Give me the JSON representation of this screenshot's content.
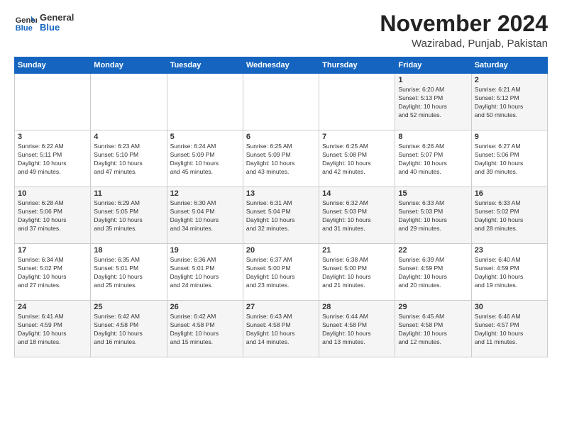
{
  "logo": {
    "general": "General",
    "blue": "Blue"
  },
  "header": {
    "month": "November 2024",
    "location": "Wazirabad, Punjab, Pakistan"
  },
  "days_of_week": [
    "Sunday",
    "Monday",
    "Tuesday",
    "Wednesday",
    "Thursday",
    "Friday",
    "Saturday"
  ],
  "weeks": [
    [
      {
        "day": "",
        "info": ""
      },
      {
        "day": "",
        "info": ""
      },
      {
        "day": "",
        "info": ""
      },
      {
        "day": "",
        "info": ""
      },
      {
        "day": "",
        "info": ""
      },
      {
        "day": "1",
        "info": "Sunrise: 6:20 AM\nSunset: 5:13 PM\nDaylight: 10 hours\nand 52 minutes."
      },
      {
        "day": "2",
        "info": "Sunrise: 6:21 AM\nSunset: 5:12 PM\nDaylight: 10 hours\nand 50 minutes."
      }
    ],
    [
      {
        "day": "3",
        "info": "Sunrise: 6:22 AM\nSunset: 5:11 PM\nDaylight: 10 hours\nand 49 minutes."
      },
      {
        "day": "4",
        "info": "Sunrise: 6:23 AM\nSunset: 5:10 PM\nDaylight: 10 hours\nand 47 minutes."
      },
      {
        "day": "5",
        "info": "Sunrise: 6:24 AM\nSunset: 5:09 PM\nDaylight: 10 hours\nand 45 minutes."
      },
      {
        "day": "6",
        "info": "Sunrise: 6:25 AM\nSunset: 5:09 PM\nDaylight: 10 hours\nand 43 minutes."
      },
      {
        "day": "7",
        "info": "Sunrise: 6:25 AM\nSunset: 5:08 PM\nDaylight: 10 hours\nand 42 minutes."
      },
      {
        "day": "8",
        "info": "Sunrise: 6:26 AM\nSunset: 5:07 PM\nDaylight: 10 hours\nand 40 minutes."
      },
      {
        "day": "9",
        "info": "Sunrise: 6:27 AM\nSunset: 5:06 PM\nDaylight: 10 hours\nand 39 minutes."
      }
    ],
    [
      {
        "day": "10",
        "info": "Sunrise: 6:28 AM\nSunset: 5:06 PM\nDaylight: 10 hours\nand 37 minutes."
      },
      {
        "day": "11",
        "info": "Sunrise: 6:29 AM\nSunset: 5:05 PM\nDaylight: 10 hours\nand 35 minutes."
      },
      {
        "day": "12",
        "info": "Sunrise: 6:30 AM\nSunset: 5:04 PM\nDaylight: 10 hours\nand 34 minutes."
      },
      {
        "day": "13",
        "info": "Sunrise: 6:31 AM\nSunset: 5:04 PM\nDaylight: 10 hours\nand 32 minutes."
      },
      {
        "day": "14",
        "info": "Sunrise: 6:32 AM\nSunset: 5:03 PM\nDaylight: 10 hours\nand 31 minutes."
      },
      {
        "day": "15",
        "info": "Sunrise: 6:33 AM\nSunset: 5:03 PM\nDaylight: 10 hours\nand 29 minutes."
      },
      {
        "day": "16",
        "info": "Sunrise: 6:33 AM\nSunset: 5:02 PM\nDaylight: 10 hours\nand 28 minutes."
      }
    ],
    [
      {
        "day": "17",
        "info": "Sunrise: 6:34 AM\nSunset: 5:02 PM\nDaylight: 10 hours\nand 27 minutes."
      },
      {
        "day": "18",
        "info": "Sunrise: 6:35 AM\nSunset: 5:01 PM\nDaylight: 10 hours\nand 25 minutes."
      },
      {
        "day": "19",
        "info": "Sunrise: 6:36 AM\nSunset: 5:01 PM\nDaylight: 10 hours\nand 24 minutes."
      },
      {
        "day": "20",
        "info": "Sunrise: 6:37 AM\nSunset: 5:00 PM\nDaylight: 10 hours\nand 23 minutes."
      },
      {
        "day": "21",
        "info": "Sunrise: 6:38 AM\nSunset: 5:00 PM\nDaylight: 10 hours\nand 21 minutes."
      },
      {
        "day": "22",
        "info": "Sunrise: 6:39 AM\nSunset: 4:59 PM\nDaylight: 10 hours\nand 20 minutes."
      },
      {
        "day": "23",
        "info": "Sunrise: 6:40 AM\nSunset: 4:59 PM\nDaylight: 10 hours\nand 19 minutes."
      }
    ],
    [
      {
        "day": "24",
        "info": "Sunrise: 6:41 AM\nSunset: 4:59 PM\nDaylight: 10 hours\nand 18 minutes."
      },
      {
        "day": "25",
        "info": "Sunrise: 6:42 AM\nSunset: 4:58 PM\nDaylight: 10 hours\nand 16 minutes."
      },
      {
        "day": "26",
        "info": "Sunrise: 6:42 AM\nSunset: 4:58 PM\nDaylight: 10 hours\nand 15 minutes."
      },
      {
        "day": "27",
        "info": "Sunrise: 6:43 AM\nSunset: 4:58 PM\nDaylight: 10 hours\nand 14 minutes."
      },
      {
        "day": "28",
        "info": "Sunrise: 6:44 AM\nSunset: 4:58 PM\nDaylight: 10 hours\nand 13 minutes."
      },
      {
        "day": "29",
        "info": "Sunrise: 6:45 AM\nSunset: 4:58 PM\nDaylight: 10 hours\nand 12 minutes."
      },
      {
        "day": "30",
        "info": "Sunrise: 6:46 AM\nSunset: 4:57 PM\nDaylight: 10 hours\nand 11 minutes."
      }
    ]
  ]
}
